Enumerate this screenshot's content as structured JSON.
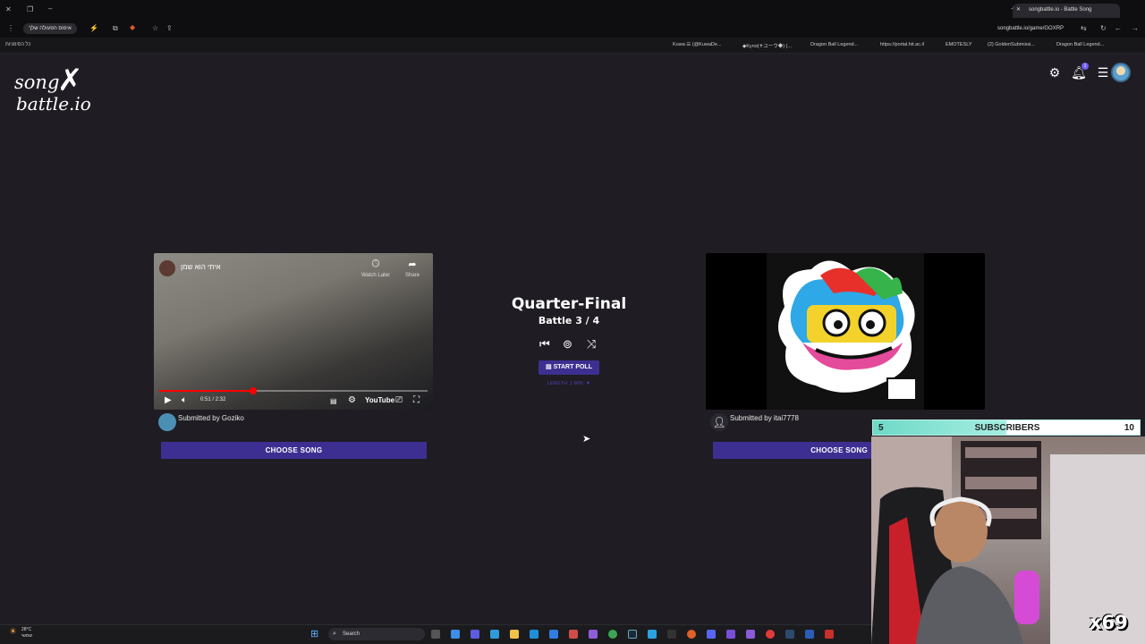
{
  "browser": {
    "hebrew_pill": "איפוס הפעולה שלך",
    "tab_title": "songbattle.io - Battle Song",
    "url": "songbattle.io/game/GOXRP",
    "bookmarks_label": "כל הסימניות",
    "bookmarks": [
      "Kuwa ☰ (@KuwaDe...",
      "◆Kyroi(✝ユーウ◆) (...",
      "Dragon Ball Legend...",
      "https://portal.hit.ac.il",
      "EMOTESLY",
      "(2) GoldenSubmissi...",
      "Dragon Ball Legend..."
    ]
  },
  "app": {
    "logo_line1": "song",
    "logo_line2": "battle.io",
    "notification_count": "1",
    "colors": {
      "accent": "#3d2f91",
      "background": "#1f1d23"
    }
  },
  "battle": {
    "round": "Quarter-Final",
    "battle": "Battle 3 / 4",
    "poll_button": "START POLL",
    "length_label": "LENGTH: 1 MIN. ▼"
  },
  "left_song": {
    "video_title": "איתי הוא שמן",
    "watch_later": "Watch Later",
    "share": "Share",
    "time": "0:51 / 2:32",
    "progress": 0.35,
    "youtube_label": "YouTube",
    "submitted_by": "Submitted by Goziko",
    "choose_button": "CHOOSE SONG"
  },
  "right_song": {
    "submitted_by": "Submitted by itai7778",
    "choose_button": "CHOOSE SONG"
  },
  "overlay": {
    "subs_label": "SUBSCRIBERS",
    "subs_current": "5",
    "subs_goal": "10",
    "multiplier": "x69"
  },
  "taskbar": {
    "temperature": "28°C",
    "weather_desc": "שמשי",
    "search": "Search"
  }
}
